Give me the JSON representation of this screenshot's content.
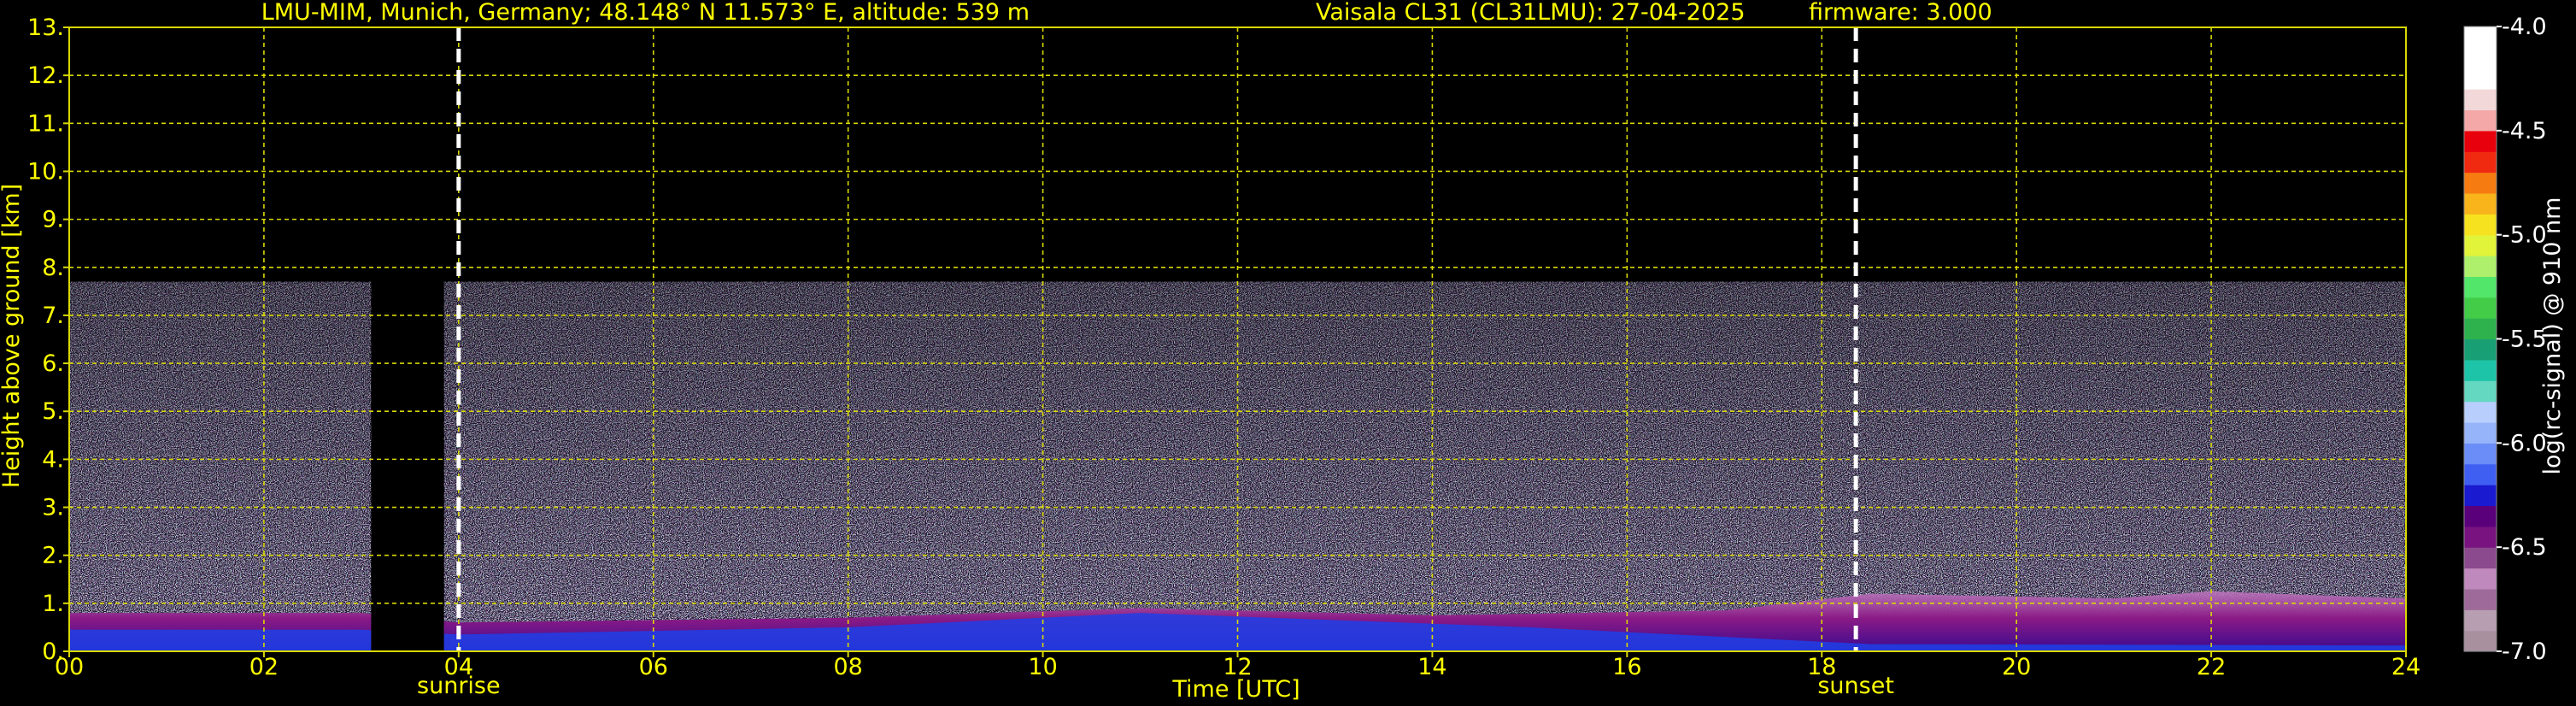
{
  "header": {
    "station": "LMU-MIM, Munich, Germany; 48.148° N 11.573° E, altitude: 539 m",
    "instrument": "Vaisala CL31 (CL31LMU): 27-04-2025",
    "firmware": "firmware: 3.000"
  },
  "colors": {
    "text": "#ffff00",
    "grid": "#d8d800",
    "background": "#000000",
    "marker": "#ffffff",
    "colorbar_text": "#ffffff"
  },
  "chart_data": {
    "type": "heatmap",
    "xlabel": "Time [UTC]",
    "ylabel": "Height above ground [km]",
    "xlim": [
      0,
      24
    ],
    "ylim": [
      0,
      13
    ],
    "x_ticks": [
      "00",
      "02",
      "04",
      "06",
      "08",
      "10",
      "12",
      "14",
      "16",
      "18",
      "20",
      "22",
      "24"
    ],
    "y_ticks": [
      "0.",
      "1.",
      "2.",
      "3.",
      "4.",
      "5.",
      "6.",
      "7.",
      "8.",
      "9.",
      "10.",
      "11.",
      "12.",
      "13."
    ],
    "grid": true,
    "data_gaps": [
      [
        3.1,
        3.85
      ]
    ],
    "signal_top_km": 7.7,
    "boundary_layer_km": [
      {
        "t": 0,
        "h": 0.8
      },
      {
        "t": 3,
        "h": 0.8
      },
      {
        "t": 4,
        "h": 0.6
      },
      {
        "t": 8,
        "h": 0.7
      },
      {
        "t": 11,
        "h": 0.9
      },
      {
        "t": 14,
        "h": 0.75
      },
      {
        "t": 17,
        "h": 0.85
      },
      {
        "t": 18.5,
        "h": 1.2
      },
      {
        "t": 21,
        "h": 1.1
      },
      {
        "t": 22,
        "h": 1.25
      },
      {
        "t": 24,
        "h": 1.1
      }
    ],
    "annotations": [
      {
        "label": "sunrise",
        "x": 4.0
      },
      {
        "label": "sunset",
        "x": 18.35
      }
    ],
    "colorbar": {
      "label": "log(rc-signal) @ 910 nm",
      "range": [
        -7.0,
        -4.0
      ],
      "ticks": [
        "-4.0",
        "-4.5",
        "-5.0",
        "-5.5",
        "-6.0",
        "-6.5",
        "-7.0"
      ],
      "colors": [
        "#a8909f",
        "#b79fb1",
        "#9e6a9a",
        "#c089bd",
        "#8b4a8e",
        "#78137f",
        "#5a007b",
        "#1a1ad0",
        "#3f5ff2",
        "#6a8df7",
        "#96b4fa",
        "#b8cffd",
        "#64d8c0",
        "#1ec4a8",
        "#18a074",
        "#2eb24e",
        "#42cc48",
        "#52e66a",
        "#aef06c",
        "#e2f43a",
        "#f6e21e",
        "#f8b41a",
        "#f67c12",
        "#ef2a10",
        "#e8000c",
        "#f4a8a8",
        "#f2d8d8",
        "#ffffff",
        "#ffffff",
        "#ffffff"
      ]
    }
  }
}
